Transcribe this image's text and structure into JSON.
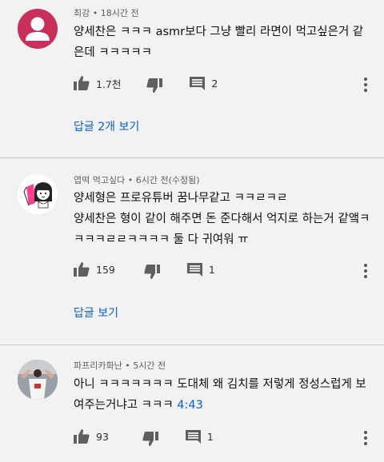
{
  "comments": [
    {
      "author": "최강",
      "time": "18시간 전",
      "lines": [
        "양세찬은 ㅋㅋㅋ asmr보다  그냥 빨리 라면이 먹고싶은거 같",
        "은데 ㅋㅋㅋㅋㅋ"
      ],
      "likes": "1.7천",
      "reply_count": "2",
      "replies_label": "답글 2개 보기",
      "avatar": "default-user-avatar"
    },
    {
      "author": "엽떡 먹고싶다",
      "time": "6시간 전(수정됨)",
      "lines": [
        "양세형은 프로유튜버 꿈나무같고 ㅋㅋㄹㅋㄹ",
        "양세찬은 형이 같이 해주면 돈 준다해서 억지로 하는거 같앸ㅋ",
        "ㅋㅋㅋㄹㄹㅋㅋㅋㅋ 둘 다 귀여워 ㅠ"
      ],
      "likes": "159",
      "reply_count": "1",
      "replies_label": "답글 보기",
      "avatar": "illustrated-girl-avatar"
    },
    {
      "author": "파프리카화난",
      "time": "5시간 전",
      "lines": [
        "아니 ㅋㅋㅋㅋㅋㅋㅋ 도대체 왜 김치를 저렇게 정성스럽게 보",
        "여주는거냐고 ㅋㅋㅋ "
      ],
      "timestamp_link": "4:43",
      "likes": "93",
      "reply_count": "1",
      "avatar": "photo-person-avatar"
    }
  ],
  "meta_separator": "•",
  "colors": {
    "background": "#f2f2f2",
    "link": "#065fd4",
    "avatar_default": "#c8305a",
    "text": "#0f0f0f"
  }
}
